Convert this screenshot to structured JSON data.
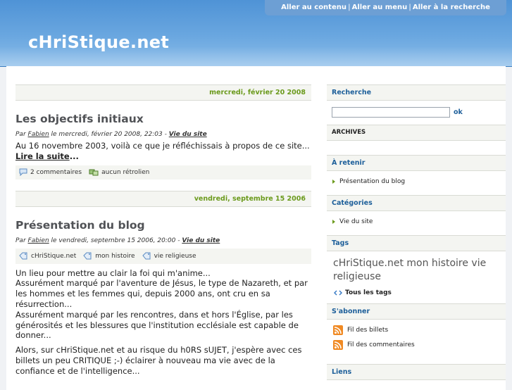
{
  "topnav": {
    "content": "Aller au contenu",
    "menu": "Aller au menu",
    "search": "Aller à la recherche",
    "sep": "|"
  },
  "site": {
    "title": "cHriStique.net"
  },
  "posts": [
    {
      "date": "mercredi, février 20 2008",
      "title": "Les objectifs initiaux",
      "info_prefix": "Par ",
      "author": "Fabien",
      "info_middle": " le mercredi, février 20 2008, 22:03 - ",
      "category": "Vie du site",
      "text": "Au 16 novembre 2003, voilà ce que je réfléchissais à propos de ce site...",
      "more": "Lire la suite",
      "more_suffix": "...",
      "comments": "2 commentaires",
      "trackbacks": "aucun rétrolien"
    },
    {
      "date": "vendredi, septembre 15 2006",
      "title": "Présentation du blog",
      "info_prefix": "Par ",
      "author": "Fabien",
      "info_middle": " le vendredi, septembre 15 2006, 20:00 - ",
      "category": "Vie du site",
      "tags": [
        "cHriStique.net",
        "mon histoire",
        "vie religieuse"
      ],
      "p1": "Un lieu pour mettre au clair la foi qui m'anime...",
      "p2": "Assurément marqué par l'aventure de Jésus, le type de Nazareth, et par les hommes et les femmes qui, depuis 2000 ans, ont cru en sa résurrection...",
      "p3": "Assurément marqué par les rencontres, dans et hors l'Église, par les générosités et les blessures que l'institution ecclésiale est capable de donner...",
      "p4": "Alors, sur cHriStique.net et au risque du h0RS sUJET, j'espère avec ces billets un peu CRITIQUE ;-) éclairer à nouveau ma vie avec de la confiance et de l'intelligence..."
    }
  ],
  "sidebar": {
    "search_title": "Recherche",
    "search_value": "",
    "search_button": "ok",
    "archives": "ARCHIVES",
    "retenir_title": "À retenir",
    "retenir_items": [
      "Présentation du blog"
    ],
    "categories_title": "Catégories",
    "categories_items": [
      "Vie du site"
    ],
    "tags_title": "Tags",
    "tags_cloud": "cHriStique.net mon histoire vie religieuse",
    "all_tags": "Tous les tags",
    "subscribe_title": "S'abonner",
    "feed_posts": "Fil des billets",
    "feed_comments": "Fil des commentaires",
    "links_title": "Liens"
  },
  "colors": {
    "header_blue": "#4f93d6",
    "date_green": "#6b9a1c",
    "side_title_blue": "#1d5f9a"
  }
}
